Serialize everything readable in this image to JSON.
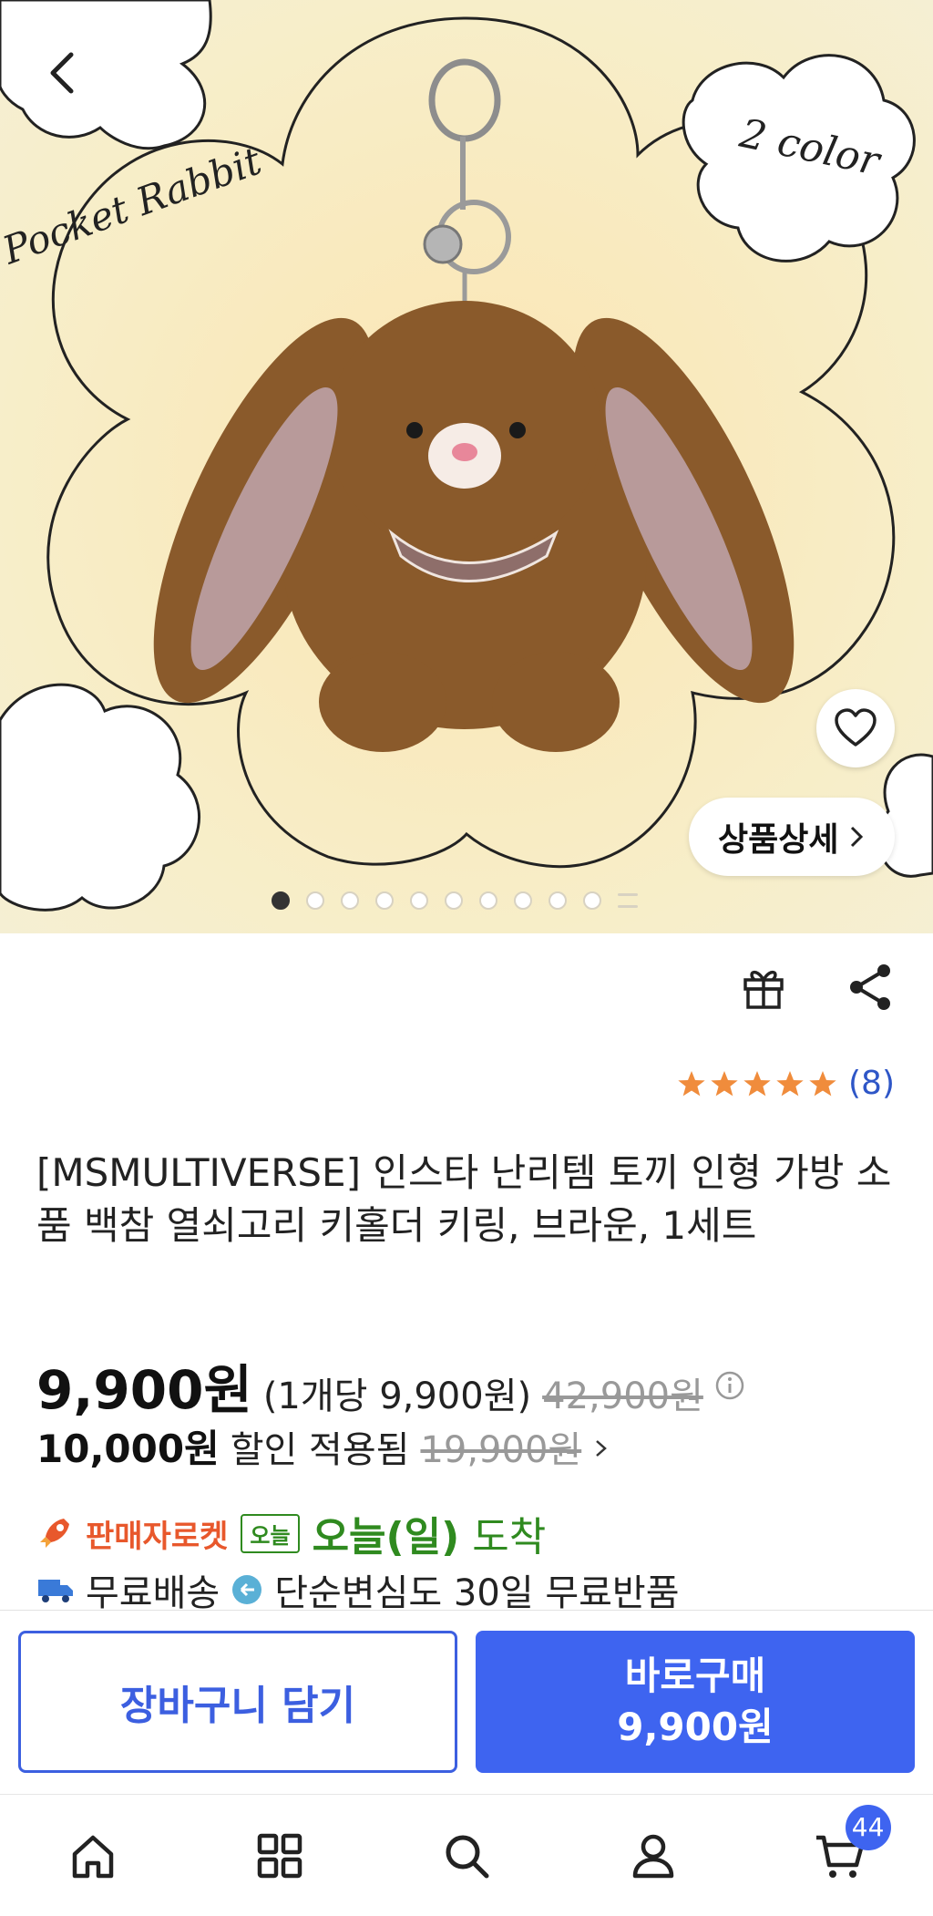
{
  "hero": {
    "script_left": "Pocket Rabbit",
    "script_right": "2 color",
    "detail_label": "상품상세",
    "slide_count": 11,
    "active_slide": 1
  },
  "rating": {
    "stars": 5,
    "count_text": "(8)"
  },
  "product": {
    "title": "[MSMULTIVERSE] 인스타 난리템 토끼 인형 가방 소품 백참 열쇠고리 키홀더 키링, 브라운, 1세트"
  },
  "price": {
    "main": "9,900원",
    "unit_price": "(1개당 9,900원)",
    "original": "42,900원"
  },
  "discount": {
    "amount": "10,000원",
    "text": "할인 적용됨",
    "original": "19,900원"
  },
  "delivery": {
    "rocket_label": "판매자로켓",
    "today_badge": "오늘",
    "arrive_bold": "오늘(일)",
    "arrive": "도착",
    "free_shipping": "무료배송",
    "free_return": "단순변심도 30일 무료반품"
  },
  "buttons": {
    "cart": "장바구니 담기",
    "buy_line1": "바로구매",
    "buy_line2": "9,900원"
  },
  "nav": {
    "cart_badge": "44"
  },
  "colors": {
    "accent": "#3e64f0",
    "star": "#f08c3c",
    "green": "#2f8a1f",
    "rocket": "#e8582c"
  },
  "icons": [
    "back-icon",
    "heart-icon",
    "chevron-right-icon",
    "gift-icon",
    "share-icon",
    "star-icon",
    "info-icon",
    "rocket-icon",
    "truck-icon",
    "return-icon",
    "home-icon",
    "category-icon",
    "search-icon",
    "user-icon",
    "cart-icon"
  ]
}
